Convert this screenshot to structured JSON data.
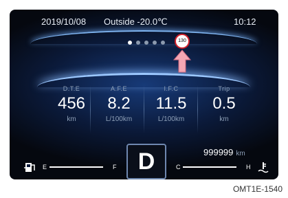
{
  "status_bar": {
    "date": "2019/10/08",
    "outside_temp": "Outside -20.0℃",
    "time": "10:12"
  },
  "speed_limit": {
    "value": "130",
    "icon": "speed-limit-sign-icon"
  },
  "pager": {
    "count": 5,
    "active_index": 0
  },
  "metrics": [
    {
      "label": "D.T.E",
      "value": "456",
      "unit": "km"
    },
    {
      "label": "A.F.E",
      "value": "8.2",
      "unit": "L/100km"
    },
    {
      "label": "I.F.C",
      "value": "11.5",
      "unit": "L/100km"
    },
    {
      "label": "Trip",
      "value": "0.5",
      "unit": "km"
    }
  ],
  "odometer": {
    "value": "999999",
    "unit": "km"
  },
  "gear": "D",
  "fuel_gauge": {
    "empty_label": "E",
    "full_label": "F",
    "icon": "fuel-pump-icon"
  },
  "temp_gauge": {
    "cold_label": "C",
    "hot_label": "H",
    "icon": "coolant-temperature-icon"
  },
  "caption": "OMT1E-1540",
  "colors": {
    "arrow": "#f4a7b4",
    "glow": "#9cc8ff",
    "speed_sign_ring": "#d0202a"
  }
}
